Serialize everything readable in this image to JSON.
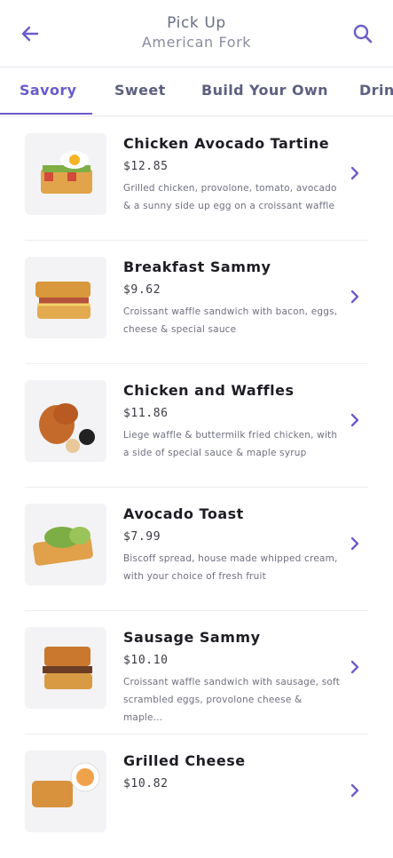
{
  "header": {
    "title": "Pick Up",
    "location": "American Fork"
  },
  "tabs": [
    "Savory",
    "Sweet",
    "Build Your Own",
    "Drin"
  ],
  "items": [
    {
      "name": "Chicken Avocado Tartine",
      "price": "$12.85",
      "description": "Grilled chicken, provolone, tomato, avocado & a sunny side up egg on a croissant waffle"
    },
    {
      "name": "Breakfast Sammy",
      "price": "$9.62",
      "description": "Croissant waffle sandwich with bacon, eggs, cheese & special sauce"
    },
    {
      "name": "Chicken and Waffles",
      "price": "$11.86",
      "description": "Liege waffle & buttermilk fried chicken, with a side of special sauce & maple syrup"
    },
    {
      "name": "Avocado Toast",
      "price": "$7.99",
      "description": "Biscoff spread, house made whipped cream, with your choice of fresh fruit"
    },
    {
      "name": "Sausage Sammy",
      "price": "$10.10",
      "description": "Croissant waffle sandwich with sausage, soft scrambled eggs, provolone cheese & maple..."
    },
    {
      "name": "Grilled Cheese",
      "price": "$10.82",
      "description": ""
    }
  ],
  "colors": {
    "accent": "#6a5cc9",
    "text": "#1d1d24",
    "muted": "#6f7080"
  }
}
